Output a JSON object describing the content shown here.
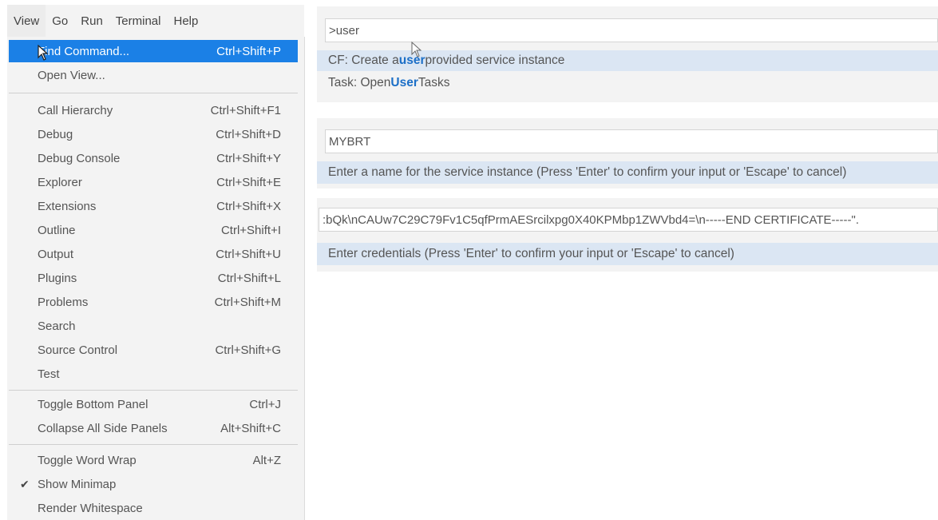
{
  "menubar": {
    "items": [
      "View",
      "Go",
      "Run",
      "Terminal",
      "Help"
    ]
  },
  "view_menu": {
    "items": [
      {
        "label": "Find Command...",
        "shortcut": "Ctrl+Shift+P"
      },
      {
        "label": "Open View...",
        "shortcut": ""
      },
      {
        "label": "Call Hierarchy",
        "shortcut": "Ctrl+Shift+F1"
      },
      {
        "label": "Debug",
        "shortcut": "Ctrl+Shift+D"
      },
      {
        "label": "Debug Console",
        "shortcut": "Ctrl+Shift+Y"
      },
      {
        "label": "Explorer",
        "shortcut": "Ctrl+Shift+E"
      },
      {
        "label": "Extensions",
        "shortcut": "Ctrl+Shift+X"
      },
      {
        "label": "Outline",
        "shortcut": "Ctrl+Shift+I"
      },
      {
        "label": "Output",
        "shortcut": "Ctrl+Shift+U"
      },
      {
        "label": "Plugins",
        "shortcut": "Ctrl+Shift+L"
      },
      {
        "label": "Problems",
        "shortcut": "Ctrl+Shift+M"
      },
      {
        "label": "Search",
        "shortcut": ""
      },
      {
        "label": "Source Control",
        "shortcut": "Ctrl+Shift+G"
      },
      {
        "label": "Test",
        "shortcut": ""
      },
      {
        "label": "Toggle Bottom Panel",
        "shortcut": "Ctrl+J"
      },
      {
        "label": "Collapse All Side Panels",
        "shortcut": "Alt+Shift+C"
      },
      {
        "label": "Toggle Word Wrap",
        "shortcut": "Alt+Z"
      },
      {
        "label": "Show Minimap",
        "shortcut": ""
      },
      {
        "label": "Render Whitespace",
        "shortcut": ""
      }
    ],
    "checkmark": "✔"
  },
  "panel1": {
    "input_value": ">user",
    "result1": {
      "before": "CF: Create a ",
      "match": "user",
      "after": " provided service instance"
    },
    "result2": {
      "before": "Task: Open ",
      "match": "User",
      "after": " Tasks"
    }
  },
  "panel2": {
    "input_value": "MYBRT",
    "hint": "Enter a name for the service instance (Press 'Enter' to confirm your input or 'Escape' to cancel)"
  },
  "panel3": {
    "input_value": ":bQk\\nCAUw7C29C79Fv1C5qfPrmAESrcilxpg0X40KPMbp1ZWVbd4=\\n-----END CERTIFICATE-----\".",
    "hint": "Enter credentials (Press 'Enter' to confirm your input or 'Escape' to cancel)"
  },
  "colors": {
    "accent": "#1b80e6",
    "match": "#1c6fc7",
    "highlight": "#dbe6f3",
    "background": "#f3f3f3"
  }
}
